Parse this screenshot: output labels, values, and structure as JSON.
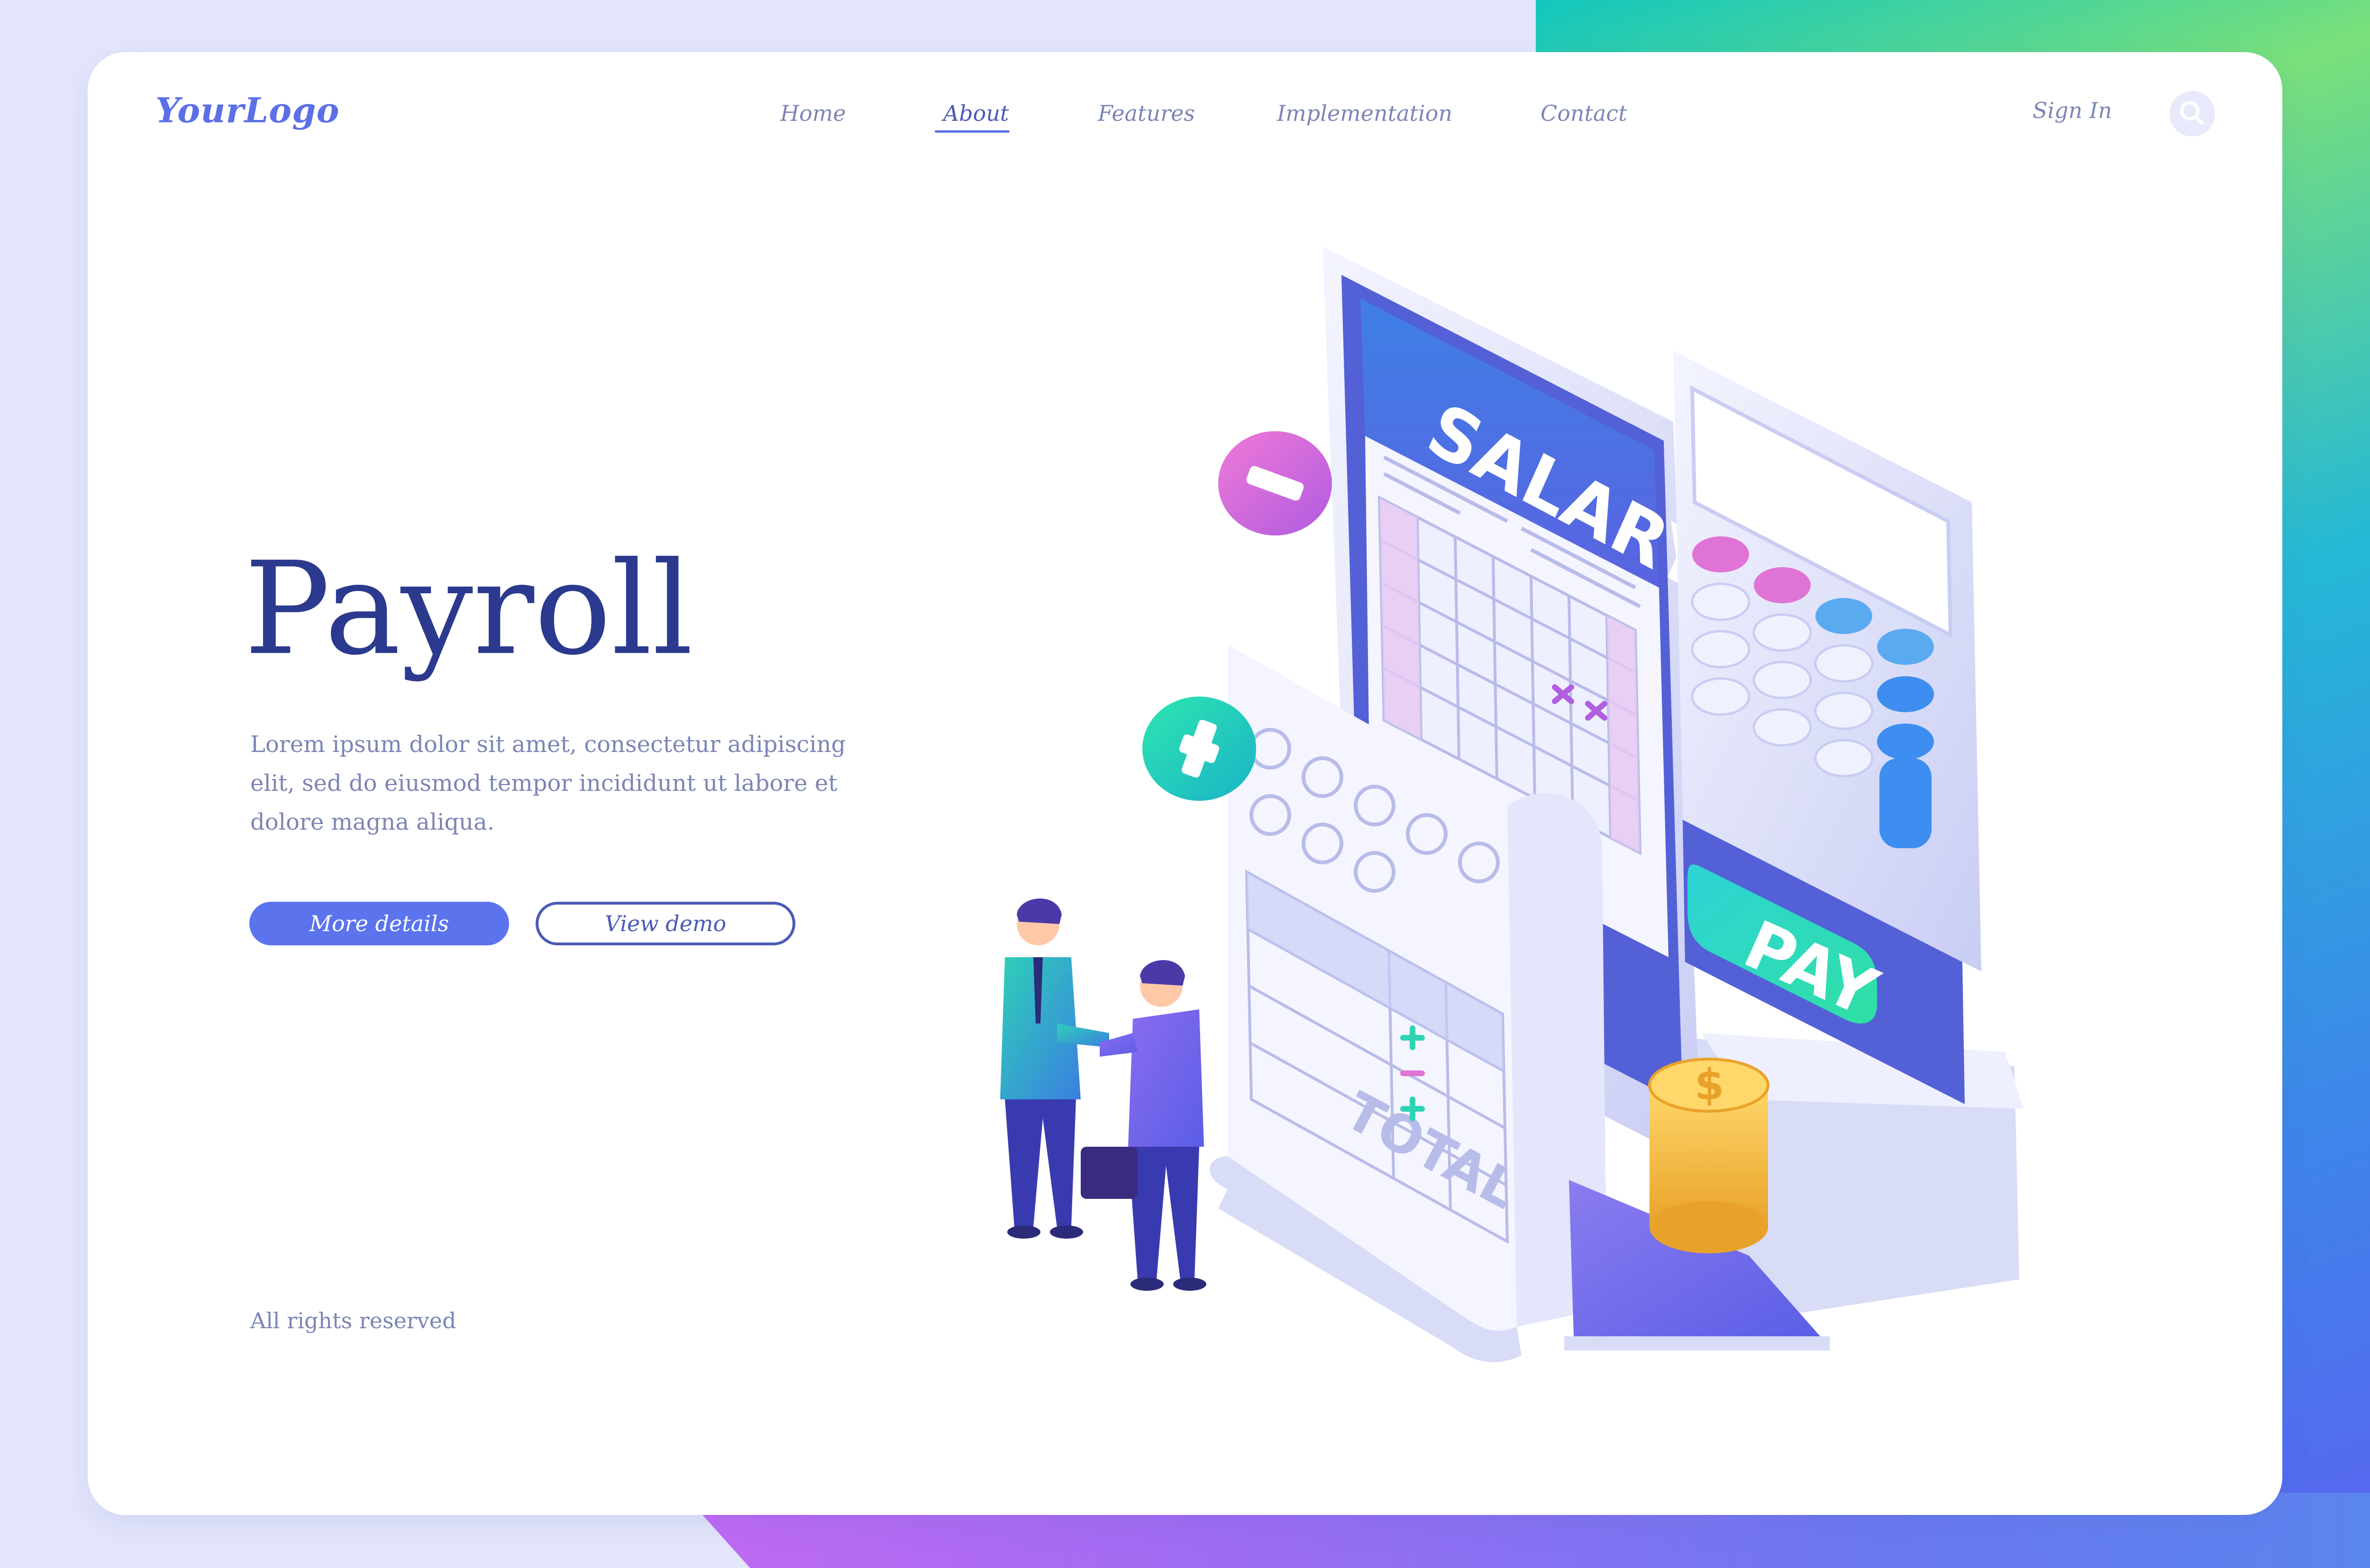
{
  "header": {
    "logo": "YourLogo",
    "nav": [
      {
        "label": "Home",
        "active": false
      },
      {
        "label": "About",
        "active": true
      },
      {
        "label": "Features",
        "active": false
      },
      {
        "label": "Implementation",
        "active": false
      },
      {
        "label": "Contact",
        "active": false
      }
    ],
    "sign_in": "Sign In",
    "search_icon": "search-icon"
  },
  "hero": {
    "title": "Payroll",
    "description": "Lorem ipsum dolor sit amet, consectetur adipiscing elit, sed do eiusmod tempor incididunt ut labore et dolore magna aliqua.",
    "primary_button": "More details",
    "secondary_button": "View demo"
  },
  "footer": {
    "text": "All rights reserved"
  },
  "illustration": {
    "salary_label": "SALARY",
    "pay_label": "PAY",
    "total_label": "TOTAL",
    "coin_symbol": "$"
  },
  "colors": {
    "accent": "#5b74ee",
    "title": "#2b3a8f",
    "text": "#7b86b5",
    "card": "#ffffff"
  }
}
